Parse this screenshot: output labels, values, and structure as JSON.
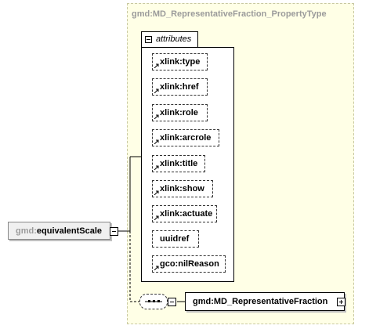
{
  "type_box": {
    "title": "gmd:MD_RepresentativeFraction_PropertyType"
  },
  "attributes_group": {
    "label": "attributes",
    "items": [
      {
        "label": "xlink:type"
      },
      {
        "label": "xlink:href"
      },
      {
        "label": "xlink:role"
      },
      {
        "label": "xlink:arcrole"
      },
      {
        "label": "xlink:title"
      },
      {
        "label": "xlink:show"
      },
      {
        "label": "xlink:actuate"
      },
      {
        "label": "uuidref"
      },
      {
        "label": "gco:nilReason"
      }
    ]
  },
  "element": {
    "prefix": "gmd:",
    "name": "equivalentScale"
  },
  "child_element": {
    "label": "gmd:MD_RepresentativeFraction"
  },
  "colors": {
    "type_background": "#ffffe6",
    "prefix_gray": "#9b9b9b"
  },
  "icons": {
    "attribute": "ref-arrow-icon",
    "collapse": "minus-icon",
    "expand": "plus-icon",
    "sequence": "sequence-icon"
  }
}
